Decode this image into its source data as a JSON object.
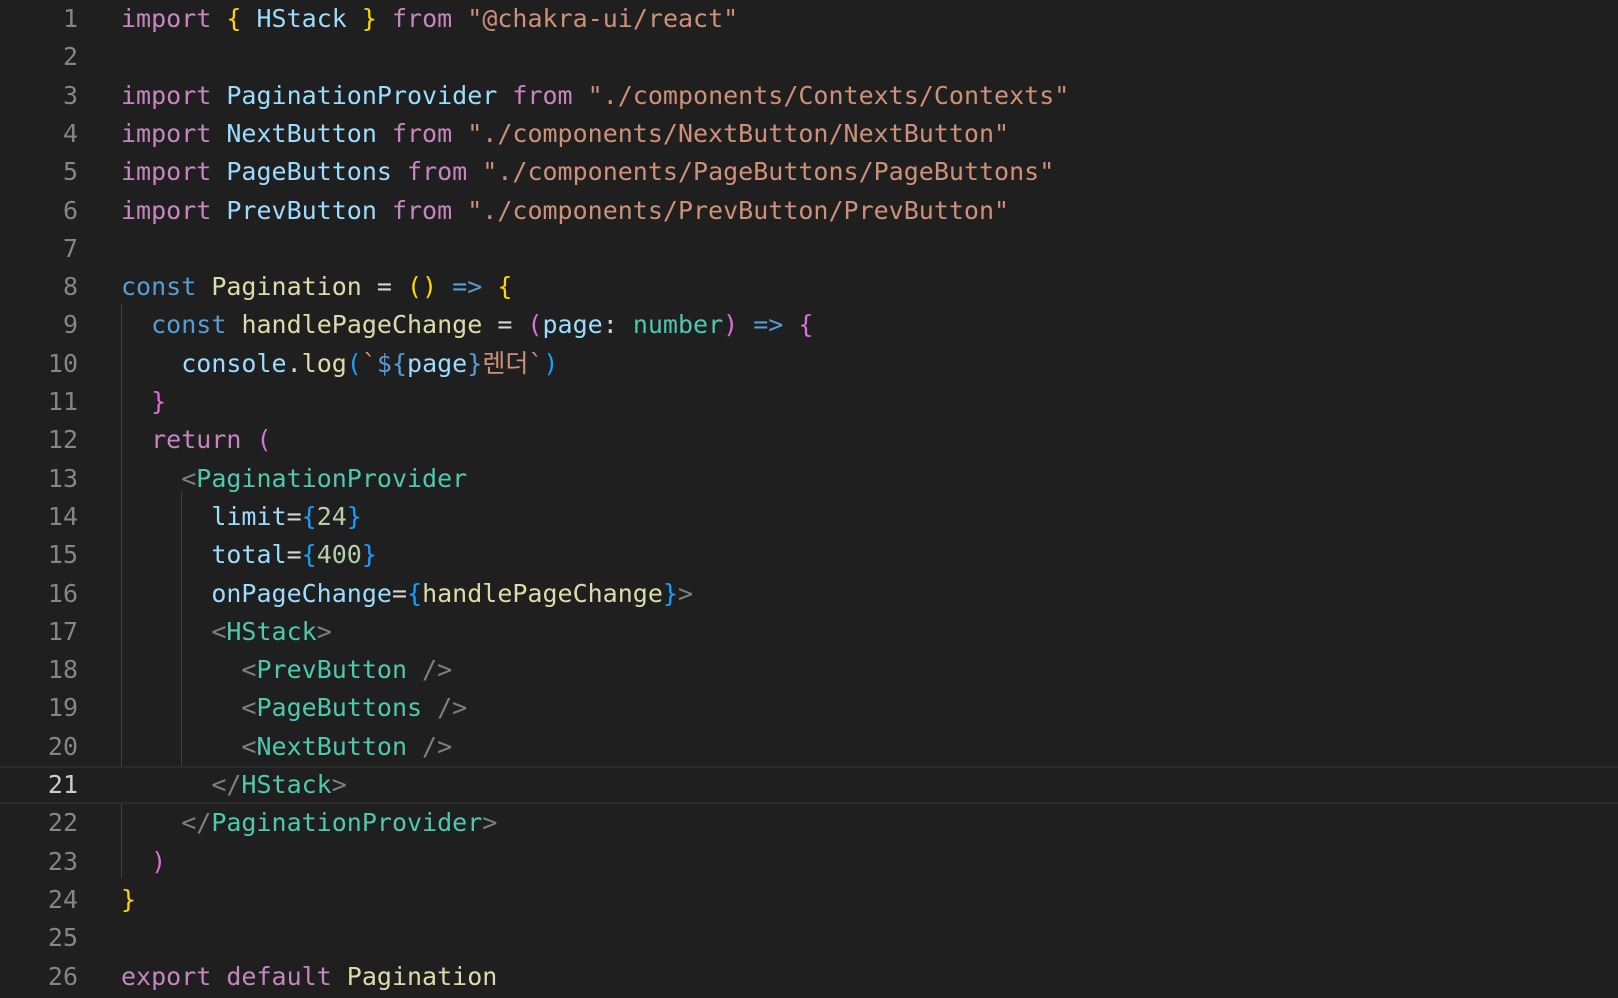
{
  "editor": {
    "current_line": 21,
    "lines": [
      {
        "n": "1",
        "tokens": [
          {
            "t": "import",
            "c": "kw-ctrl"
          },
          {
            "t": " ",
            "c": "plain"
          },
          {
            "t": "{",
            "c": "b1"
          },
          {
            "t": " ",
            "c": "plain"
          },
          {
            "t": "HStack",
            "c": "ident"
          },
          {
            "t": " ",
            "c": "plain"
          },
          {
            "t": "}",
            "c": "b1"
          },
          {
            "t": " ",
            "c": "plain"
          },
          {
            "t": "from",
            "c": "kw-ctrl"
          },
          {
            "t": " ",
            "c": "plain"
          },
          {
            "t": "\"@chakra-ui/react\"",
            "c": "str"
          }
        ]
      },
      {
        "n": "2",
        "tokens": []
      },
      {
        "n": "3",
        "tokens": [
          {
            "t": "import",
            "c": "kw-ctrl"
          },
          {
            "t": " ",
            "c": "plain"
          },
          {
            "t": "PaginationProvider",
            "c": "ident"
          },
          {
            "t": " ",
            "c": "plain"
          },
          {
            "t": "from",
            "c": "kw-ctrl"
          },
          {
            "t": " ",
            "c": "plain"
          },
          {
            "t": "\"./components/Contexts/Contexts\"",
            "c": "str"
          }
        ]
      },
      {
        "n": "4",
        "tokens": [
          {
            "t": "import",
            "c": "kw-ctrl"
          },
          {
            "t": " ",
            "c": "plain"
          },
          {
            "t": "NextButton",
            "c": "ident"
          },
          {
            "t": " ",
            "c": "plain"
          },
          {
            "t": "from",
            "c": "kw-ctrl"
          },
          {
            "t": " ",
            "c": "plain"
          },
          {
            "t": "\"./components/NextButton/NextButton\"",
            "c": "str"
          }
        ]
      },
      {
        "n": "5",
        "tokens": [
          {
            "t": "import",
            "c": "kw-ctrl"
          },
          {
            "t": " ",
            "c": "plain"
          },
          {
            "t": "PageButtons",
            "c": "ident"
          },
          {
            "t": " ",
            "c": "plain"
          },
          {
            "t": "from",
            "c": "kw-ctrl"
          },
          {
            "t": " ",
            "c": "plain"
          },
          {
            "t": "\"./components/PageButtons/PageButtons\"",
            "c": "str"
          }
        ]
      },
      {
        "n": "6",
        "tokens": [
          {
            "t": "import",
            "c": "kw-ctrl"
          },
          {
            "t": " ",
            "c": "plain"
          },
          {
            "t": "PrevButton",
            "c": "ident"
          },
          {
            "t": " ",
            "c": "plain"
          },
          {
            "t": "from",
            "c": "kw-ctrl"
          },
          {
            "t": " ",
            "c": "plain"
          },
          {
            "t": "\"./components/PrevButton/PrevButton\"",
            "c": "str"
          }
        ]
      },
      {
        "n": "7",
        "tokens": []
      },
      {
        "n": "8",
        "tokens": [
          {
            "t": "const",
            "c": "kw-decl"
          },
          {
            "t": " ",
            "c": "plain"
          },
          {
            "t": "Pagination",
            "c": "func"
          },
          {
            "t": " = ",
            "c": "op"
          },
          {
            "t": "()",
            "c": "b1"
          },
          {
            "t": " ",
            "c": "plain"
          },
          {
            "t": "=>",
            "c": "kw-decl"
          },
          {
            "t": " ",
            "c": "plain"
          },
          {
            "t": "{",
            "c": "b1"
          }
        ]
      },
      {
        "n": "9",
        "tokens": [
          {
            "t": "  ",
            "c": "plain"
          },
          {
            "t": "const",
            "c": "kw-decl"
          },
          {
            "t": " ",
            "c": "plain"
          },
          {
            "t": "handlePageChange",
            "c": "func"
          },
          {
            "t": " = ",
            "c": "op"
          },
          {
            "t": "(",
            "c": "b2"
          },
          {
            "t": "page",
            "c": "ident"
          },
          {
            "t": ": ",
            "c": "op"
          },
          {
            "t": "number",
            "c": "comp"
          },
          {
            "t": ")",
            "c": "b2"
          },
          {
            "t": " ",
            "c": "plain"
          },
          {
            "t": "=>",
            "c": "kw-decl"
          },
          {
            "t": " ",
            "c": "plain"
          },
          {
            "t": "{",
            "c": "b2"
          }
        ]
      },
      {
        "n": "10",
        "tokens": [
          {
            "t": "    ",
            "c": "plain"
          },
          {
            "t": "console",
            "c": "ident"
          },
          {
            "t": ".",
            "c": "op"
          },
          {
            "t": "log",
            "c": "func"
          },
          {
            "t": "(",
            "c": "b3"
          },
          {
            "t": "`",
            "c": "str"
          },
          {
            "t": "${",
            "c": "kw-decl"
          },
          {
            "t": "page",
            "c": "ident"
          },
          {
            "t": "}",
            "c": "kw-decl"
          },
          {
            "t": "렌더`",
            "c": "str"
          },
          {
            "t": ")",
            "c": "b3"
          }
        ]
      },
      {
        "n": "11",
        "tokens": [
          {
            "t": "  ",
            "c": "plain"
          },
          {
            "t": "}",
            "c": "b2"
          }
        ]
      },
      {
        "n": "12",
        "tokens": [
          {
            "t": "  ",
            "c": "plain"
          },
          {
            "t": "return",
            "c": "kw-ctrl"
          },
          {
            "t": " ",
            "c": "plain"
          },
          {
            "t": "(",
            "c": "b2"
          }
        ]
      },
      {
        "n": "13",
        "tokens": [
          {
            "t": "    ",
            "c": "plain"
          },
          {
            "t": "<",
            "c": "punct"
          },
          {
            "t": "PaginationProvider",
            "c": "comp"
          }
        ]
      },
      {
        "n": "14",
        "tokens": [
          {
            "t": "      ",
            "c": "plain"
          },
          {
            "t": "limit",
            "c": "ident"
          },
          {
            "t": "=",
            "c": "op"
          },
          {
            "t": "{",
            "c": "b3"
          },
          {
            "t": "24",
            "c": "num"
          },
          {
            "t": "}",
            "c": "b3"
          }
        ]
      },
      {
        "n": "15",
        "tokens": [
          {
            "t": "      ",
            "c": "plain"
          },
          {
            "t": "total",
            "c": "ident"
          },
          {
            "t": "=",
            "c": "op"
          },
          {
            "t": "{",
            "c": "b3"
          },
          {
            "t": "400",
            "c": "num"
          },
          {
            "t": "}",
            "c": "b3"
          }
        ]
      },
      {
        "n": "16",
        "tokens": [
          {
            "t": "      ",
            "c": "plain"
          },
          {
            "t": "onPageChange",
            "c": "ident"
          },
          {
            "t": "=",
            "c": "op"
          },
          {
            "t": "{",
            "c": "b3"
          },
          {
            "t": "handlePageChange",
            "c": "func"
          },
          {
            "t": "}",
            "c": "b3"
          },
          {
            "t": ">",
            "c": "punct"
          }
        ]
      },
      {
        "n": "17",
        "tokens": [
          {
            "t": "      ",
            "c": "plain"
          },
          {
            "t": "<",
            "c": "punct"
          },
          {
            "t": "HStack",
            "c": "comp"
          },
          {
            "t": ">",
            "c": "punct"
          }
        ]
      },
      {
        "n": "18",
        "tokens": [
          {
            "t": "        ",
            "c": "plain"
          },
          {
            "t": "<",
            "c": "punct"
          },
          {
            "t": "PrevButton",
            "c": "comp"
          },
          {
            "t": " />",
            "c": "punct"
          }
        ]
      },
      {
        "n": "19",
        "tokens": [
          {
            "t": "        ",
            "c": "plain"
          },
          {
            "t": "<",
            "c": "punct"
          },
          {
            "t": "PageButtons",
            "c": "comp"
          },
          {
            "t": " />",
            "c": "punct"
          }
        ]
      },
      {
        "n": "20",
        "tokens": [
          {
            "t": "        ",
            "c": "plain"
          },
          {
            "t": "<",
            "c": "punct"
          },
          {
            "t": "NextButton",
            "c": "comp"
          },
          {
            "t": " />",
            "c": "punct"
          }
        ]
      },
      {
        "n": "21",
        "tokens": [
          {
            "t": "      ",
            "c": "plain"
          },
          {
            "t": "</",
            "c": "punct"
          },
          {
            "t": "HStack",
            "c": "comp"
          },
          {
            "t": ">",
            "c": "punct"
          }
        ]
      },
      {
        "n": "22",
        "tokens": [
          {
            "t": "    ",
            "c": "plain"
          },
          {
            "t": "</",
            "c": "punct"
          },
          {
            "t": "PaginationProvider",
            "c": "comp"
          },
          {
            "t": ">",
            "c": "punct"
          }
        ]
      },
      {
        "n": "23",
        "tokens": [
          {
            "t": "  ",
            "c": "plain"
          },
          {
            "t": ")",
            "c": "b2"
          }
        ]
      },
      {
        "n": "24",
        "tokens": [
          {
            "t": "}",
            "c": "b1"
          }
        ]
      },
      {
        "n": "25",
        "tokens": []
      },
      {
        "n": "26",
        "tokens": [
          {
            "t": "export",
            "c": "kw-ctrl"
          },
          {
            "t": " ",
            "c": "plain"
          },
          {
            "t": "default",
            "c": "kw-ctrl"
          },
          {
            "t": " ",
            "c": "plain"
          },
          {
            "t": "Pagination",
            "c": "func"
          }
        ]
      }
    ]
  }
}
